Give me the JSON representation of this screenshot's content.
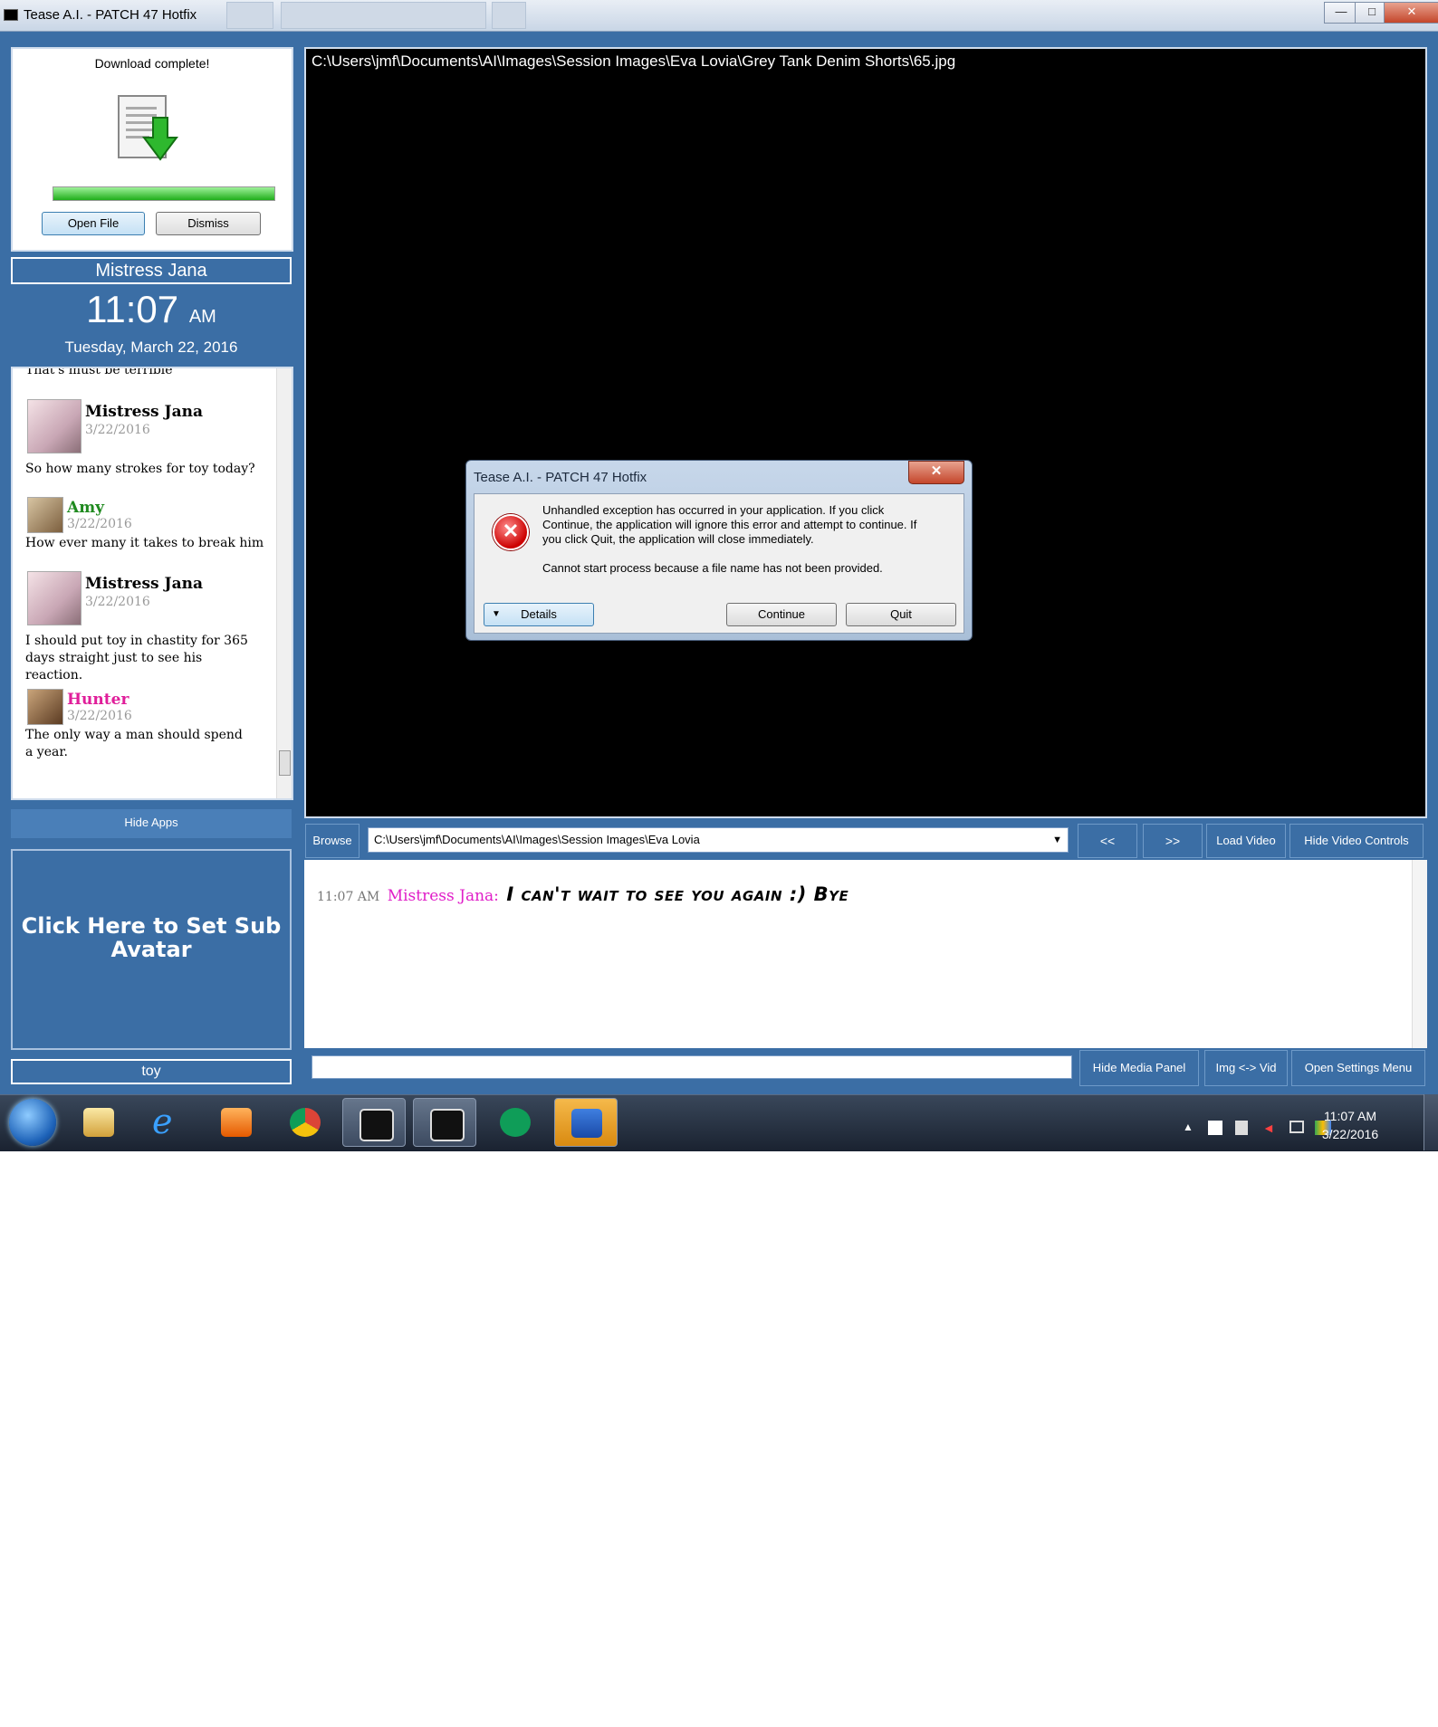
{
  "window": {
    "title": "Tease A.I. - PATCH 47 Hotfix",
    "controls": {
      "minimize": "—",
      "maximize": "□",
      "close": "✕"
    }
  },
  "download": {
    "status": "Download complete!",
    "progress": 1.0,
    "open_file": "Open File",
    "dismiss": "Dismiss"
  },
  "domme": {
    "name": "Mistress Jana",
    "time": "11:07",
    "ampm": "AM",
    "date": "Tuesday, March 22, 2016"
  },
  "chat_feed": {
    "cut_off_text": "That's must be terrible",
    "items": [
      {
        "name": "Mistress Jana",
        "name_color": "#000000",
        "date": "3/22/2016",
        "message": "So how many strokes for toy today?"
      },
      {
        "name": "Amy",
        "name_color": "#1f8a1f",
        "date": "3/22/2016",
        "message": "How ever many it takes to break him"
      },
      {
        "name": "Mistress Jana",
        "name_color": "#000000",
        "date": "3/22/2016",
        "message": "I should put toy in chastity for 365 days straight just to see his reaction."
      },
      {
        "name": "Hunter",
        "name_color": "#e01e9a",
        "date": "3/22/2016",
        "message": "The only way a man should spend a year."
      }
    ]
  },
  "sidebar": {
    "hide_apps": "Hide Apps",
    "sub_avatar": "Click Here to Set Sub Avatar",
    "sub_name": "toy"
  },
  "image_pane": {
    "path": "C:\\Users\\jmf\\Documents\\AI\\Images\\Session Images\\Eva Lovia\\Grey Tank Denim Shorts\\65.jpg"
  },
  "dialog": {
    "title": "Tease A.I. - PATCH 47 Hotfix",
    "close": "✕",
    "message": "Unhandled exception has occurred in your application. If you click Continue, the application will ignore this error and attempt to continue. If you click Quit, the application will close immediately.",
    "detail": "Cannot start process because a file name has not been provided.",
    "details_btn": "Details",
    "continue_btn": "Continue",
    "quit_btn": "Quit"
  },
  "media_controls": {
    "browse": "Browse",
    "folder_path": "C:\\Users\\jmf\\Documents\\AI\\Images\\Session Images\\Eva Lovia",
    "prev": "<<",
    "next": ">>",
    "load_video": "Load Video",
    "hide_video_controls": "Hide Video Controls"
  },
  "chat_log": {
    "time": "11:07 AM",
    "speaker": "Mistress Jana:",
    "message": "I can't wait to see you again :) Bye"
  },
  "bottom_bar": {
    "hide_media_panel": "Hide Media Panel",
    "img_vid": "Img <-> Vid",
    "open_settings": "Open Settings Menu"
  },
  "taskbar": {
    "time": "11:07 AM",
    "date": "3/22/2016",
    "apps": [
      "file-explorer-icon",
      "internet-explorer-icon",
      "media-player-icon",
      "chrome-icon",
      "tease-ai-icon",
      "tease-ai-icon-2",
      "hangouts-icon",
      "malwarebytes-icon"
    ]
  }
}
